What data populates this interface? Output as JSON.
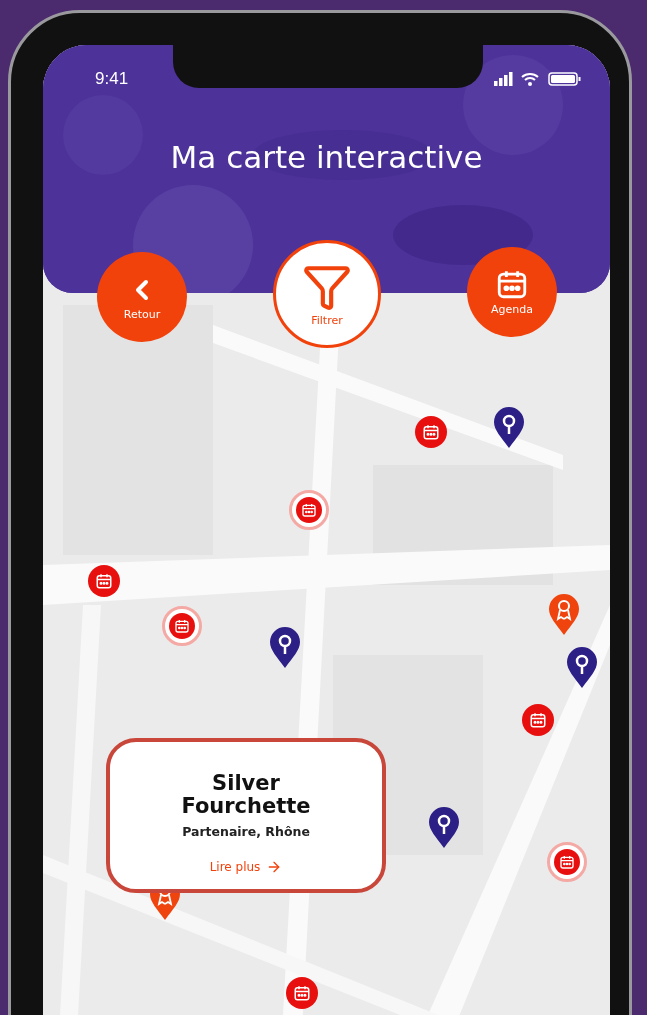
{
  "status_bar": {
    "time": "9:41"
  },
  "header": {
    "title": "Ma carte interactive"
  },
  "actions": [
    {
      "kind": "back",
      "label": "Retour"
    },
    {
      "kind": "filter",
      "label": "Filtrer"
    },
    {
      "kind": "agenda",
      "label": "Agenda"
    }
  ],
  "markers": [
    {
      "kind": "event"
    },
    {
      "kind": "place"
    },
    {
      "kind": "event_outline"
    },
    {
      "kind": "event"
    },
    {
      "kind": "event_outline"
    },
    {
      "kind": "partner"
    },
    {
      "kind": "place"
    },
    {
      "kind": "place"
    },
    {
      "kind": "event"
    },
    {
      "kind": "place"
    },
    {
      "kind": "event_outline"
    },
    {
      "kind": "partner"
    },
    {
      "kind": "event"
    }
  ],
  "popup": {
    "title": "Silver Fourchette",
    "subtitle": "Partenaire, Rhône",
    "link": "Lire plus"
  }
}
